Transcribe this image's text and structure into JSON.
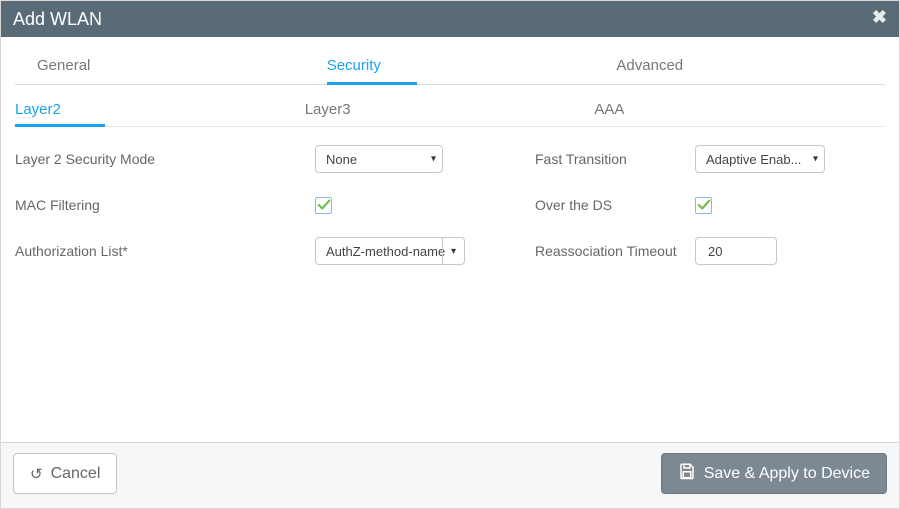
{
  "title": "Add WLAN",
  "tabs_main": [
    {
      "label": "General",
      "active": false
    },
    {
      "label": "Security",
      "active": true
    },
    {
      "label": "Advanced",
      "active": false
    }
  ],
  "tabs_sub": [
    {
      "label": "Layer2",
      "active": true
    },
    {
      "label": "Layer3",
      "active": false
    },
    {
      "label": "AAA",
      "active": false
    }
  ],
  "form": {
    "l2_security_mode": {
      "label": "Layer 2 Security Mode",
      "value": "None"
    },
    "mac_filtering": {
      "label": "MAC Filtering",
      "checked": true
    },
    "authz_list": {
      "label": "Authorization List*",
      "value": "AuthZ-method-name"
    },
    "fast_transition": {
      "label": "Fast Transition",
      "value": "Adaptive Enab..."
    },
    "over_the_ds": {
      "label": "Over the DS",
      "checked": true
    },
    "reassoc_timeout": {
      "label": "Reassociation Timeout",
      "value": "20"
    }
  },
  "footer": {
    "cancel": "Cancel",
    "apply": "Save & Apply to Device"
  }
}
